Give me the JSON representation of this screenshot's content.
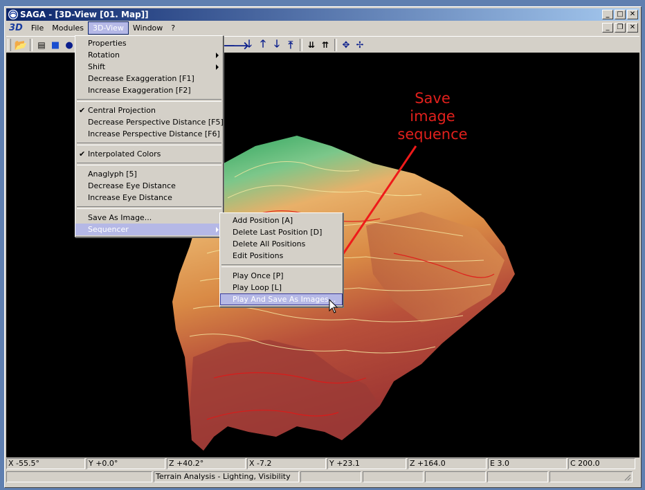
{
  "window": {
    "title": "SAGA - [3D-View [01. Map]]"
  },
  "menubar": {
    "logo": "3D",
    "items": [
      "File",
      "Modules",
      "3D-View",
      "Window",
      "?"
    ]
  },
  "menu_3dview": {
    "properties": "Properties",
    "rotation": "Rotation",
    "shift": "Shift",
    "decrease_exaggeration": "Decrease Exaggeration [F1]",
    "increase_exaggeration": "Increase Exaggeration [F2]",
    "central_projection": "Central Projection",
    "decrease_persp": "Decrease Perspective Distance [F5]",
    "increase_persp": "Increase Perspective Distance [F6]",
    "interpolated_colors": "Interpolated Colors",
    "anaglyph": "Anaglyph [5]",
    "decrease_eye": "Decrease Eye Distance",
    "increase_eye": "Increase Eye Distance",
    "save_as_image": "Save As Image...",
    "sequencer": "Sequencer"
  },
  "menu_sequencer": {
    "add_position": "Add Position [A]",
    "delete_last": "Delete Last Position [D]",
    "delete_all": "Delete All Positions",
    "edit_positions": "Edit Positions",
    "play_once": "Play Once [P]",
    "play_loop": "Play Loop [L]",
    "play_and_save": "Play And Save As Images..."
  },
  "annotation": {
    "line1": "Save",
    "line2": "image",
    "line3": "sequence"
  },
  "status_coords": [
    "X -55.5°",
    "Y +0.0°",
    "Z +40.2°",
    "X -7.2",
    "Y +23.1",
    "Z +164.0",
    "E 3.0",
    "C 200.0"
  ],
  "status_bar": {
    "message": "Terrain Analysis - Lighting, Visibility"
  },
  "colors": {
    "annotation": "#e0201c",
    "menu_highlight": "#b5b8e6",
    "title_bar": "#0a246a"
  }
}
